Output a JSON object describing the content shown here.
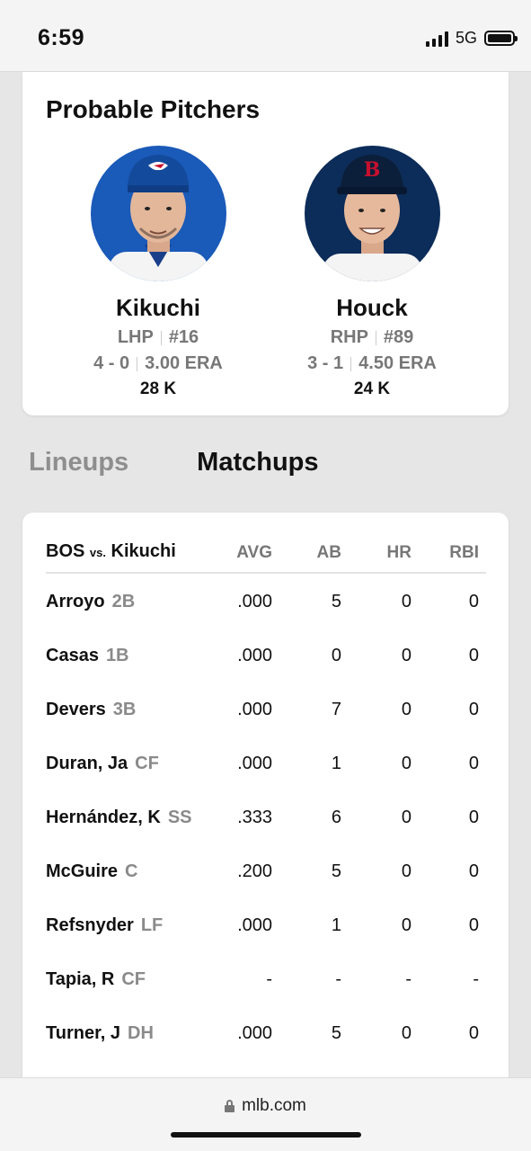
{
  "status": {
    "time": "6:59",
    "network": "5G"
  },
  "probable_pitchers": {
    "title": "Probable Pitchers",
    "pitchers": [
      {
        "name": "Kikuchi",
        "throws": "LHP",
        "number": "#16",
        "record": "4 - 0",
        "era": "3.00 ERA",
        "strikeouts": "28 K",
        "team_color": "#1a5ab8"
      },
      {
        "name": "Houck",
        "throws": "RHP",
        "number": "#89",
        "record": "3 - 1",
        "era": "4.50 ERA",
        "strikeouts": "24 K",
        "team_color": "#0c2c59"
      }
    ]
  },
  "tabs": [
    {
      "label": "Lineups",
      "active": false
    },
    {
      "label": "Matchups",
      "active": true
    }
  ],
  "matchups": {
    "team": "BOS",
    "vs": "vs.",
    "pitcher": "Kikuchi",
    "columns": [
      "AVG",
      "AB",
      "HR",
      "RBI"
    ],
    "rows": [
      {
        "name": "Arroyo",
        "pos": "2B",
        "avg": ".000",
        "ab": "5",
        "hr": "0",
        "rbi": "0"
      },
      {
        "name": "Casas",
        "pos": "1B",
        "avg": ".000",
        "ab": "0",
        "hr": "0",
        "rbi": "0"
      },
      {
        "name": "Devers",
        "pos": "3B",
        "avg": ".000",
        "ab": "7",
        "hr": "0",
        "rbi": "0"
      },
      {
        "name": "Duran, Ja",
        "pos": "CF",
        "avg": ".000",
        "ab": "1",
        "hr": "0",
        "rbi": "0"
      },
      {
        "name": "Hernández, K",
        "pos": "SS",
        "avg": ".333",
        "ab": "6",
        "hr": "0",
        "rbi": "0"
      },
      {
        "name": "McGuire",
        "pos": "C",
        "avg": ".200",
        "ab": "5",
        "hr": "0",
        "rbi": "0"
      },
      {
        "name": "Refsnyder",
        "pos": "LF",
        "avg": ".000",
        "ab": "1",
        "hr": "0",
        "rbi": "0"
      },
      {
        "name": "Tapia, R",
        "pos": "CF",
        "avg": "-",
        "ab": "-",
        "hr": "-",
        "rbi": "-"
      },
      {
        "name": "Turner, J",
        "pos": "DH",
        "avg": ".000",
        "ab": "5",
        "hr": "0",
        "rbi": "0"
      }
    ]
  },
  "browser": {
    "url": "mlb.com"
  }
}
